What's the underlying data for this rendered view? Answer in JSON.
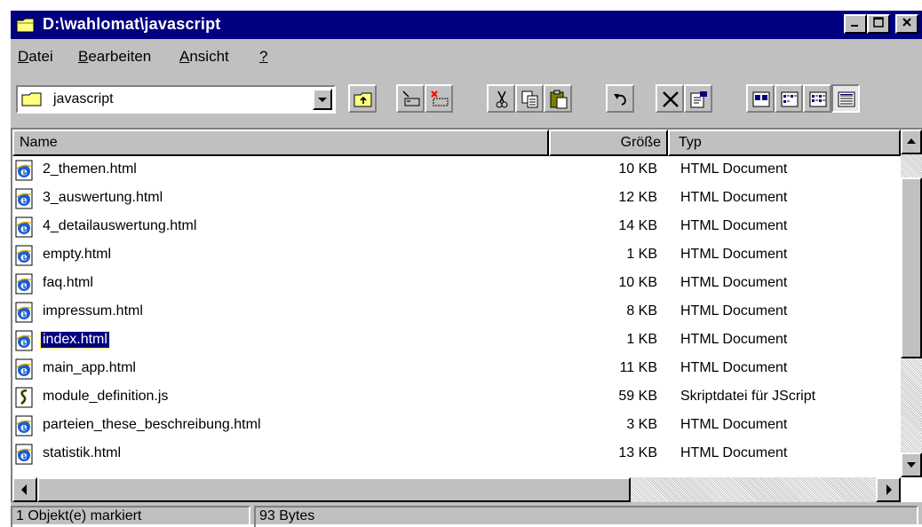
{
  "window": {
    "title": "D:\\wahlomat\\javascript"
  },
  "menu": [
    {
      "label": "Datei"
    },
    {
      "label": "Bearbeiten"
    },
    {
      "label": "Ansicht"
    },
    {
      "label": "?"
    }
  ],
  "address": {
    "value": "javascript"
  },
  "columns": {
    "name": "Name",
    "size": "Größe",
    "type": "Typ"
  },
  "files": [
    {
      "name": "2_themen.html",
      "size": "10 KB",
      "type": "HTML Document",
      "icon": "html-document-icon"
    },
    {
      "name": "3_auswertung.html",
      "size": "12 KB",
      "type": "HTML Document",
      "icon": "html-document-icon"
    },
    {
      "name": "4_detailauswertung.html",
      "size": "14 KB",
      "type": "HTML Document",
      "icon": "html-document-icon"
    },
    {
      "name": "empty.html",
      "size": "1 KB",
      "type": "HTML Document",
      "icon": "html-document-icon"
    },
    {
      "name": "faq.html",
      "size": "10 KB",
      "type": "HTML Document",
      "icon": "html-document-icon"
    },
    {
      "name": "impressum.html",
      "size": "8 KB",
      "type": "HTML Document",
      "icon": "html-document-icon"
    },
    {
      "name": "index.html",
      "size": "1 KB",
      "type": "HTML Document",
      "icon": "html-document-icon",
      "selected": true
    },
    {
      "name": "main_app.html",
      "size": "11 KB",
      "type": "HTML Document",
      "icon": "html-document-icon"
    },
    {
      "name": "module_definition.js",
      "size": "59 KB",
      "type": "Skriptdatei für JScript",
      "icon": "script-file-icon"
    },
    {
      "name": "parteien_these_beschreibung.html",
      "size": "3 KB",
      "type": "HTML Document",
      "icon": "html-document-icon"
    },
    {
      "name": "statistik.html",
      "size": "13 KB",
      "type": "HTML Document",
      "icon": "html-document-icon"
    }
  ],
  "status": {
    "selection": "1 Objekt(e) markiert",
    "bytes": "93 Bytes"
  },
  "colors": {
    "titlebar": "#000080",
    "face": "#c0c0c0",
    "selection": "#000080"
  }
}
